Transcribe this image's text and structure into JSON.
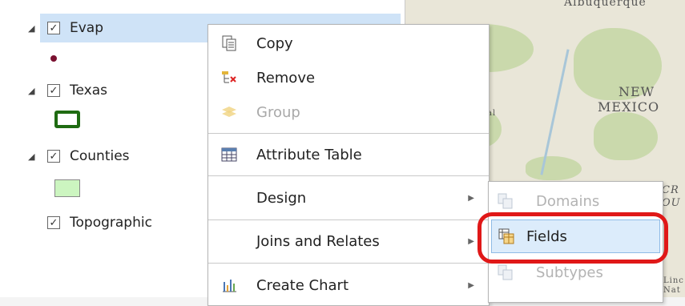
{
  "layers": [
    {
      "label": "Evap",
      "checked": true,
      "expanded": true,
      "symbol": "point-dot-maroon"
    },
    {
      "label": "Texas",
      "checked": true,
      "expanded": true,
      "symbol": "polygon-green-outline"
    },
    {
      "label": "Counties",
      "checked": true,
      "expanded": true,
      "symbol": "polygon-light-green-fill"
    },
    {
      "label": "Topographic",
      "checked": true,
      "expanded": false
    }
  ],
  "context_menu": {
    "items": [
      {
        "label": "Copy",
        "icon": "copy-icon",
        "enabled": true
      },
      {
        "label": "Remove",
        "icon": "remove-layer-icon",
        "enabled": true
      },
      {
        "label": "Group",
        "icon": "group-layers-icon",
        "enabled": false
      },
      {
        "label": "Attribute Table",
        "icon": "table-icon",
        "enabled": true
      },
      {
        "label": "Design",
        "icon": "",
        "enabled": true,
        "has_submenu": true
      },
      {
        "label": "Joins and Relates",
        "icon": "",
        "enabled": true,
        "has_submenu": true
      },
      {
        "label": "Create Chart",
        "icon": "chart-icon",
        "enabled": true,
        "has_submenu": true
      }
    ]
  },
  "submenu": {
    "items": [
      {
        "label": "Domains",
        "icon": "domains-icon",
        "enabled": false
      },
      {
        "label": "Fields",
        "icon": "fields-icon",
        "enabled": true,
        "hovered": true
      },
      {
        "label": "Subtypes",
        "icon": "subtypes-icon",
        "enabled": false
      }
    ]
  },
  "map": {
    "labels": {
      "city": "Albuquerque",
      "state_line1": "NEW",
      "state_line2": "MEXICO",
      "edge_cr": "CR",
      "edge_ou": "OU",
      "edge_al": "al",
      "edge_lin": "Linc",
      "edge_nat": "Nat"
    }
  },
  "colors": {
    "selection": "#cfe3f7",
    "highlight_ring": "#e01818",
    "evap_dot": "#7a1030",
    "texas_outline": "#1f6b12",
    "counties_fill": "#ccf5c0",
    "submenu_hover": "#dcecfb"
  }
}
